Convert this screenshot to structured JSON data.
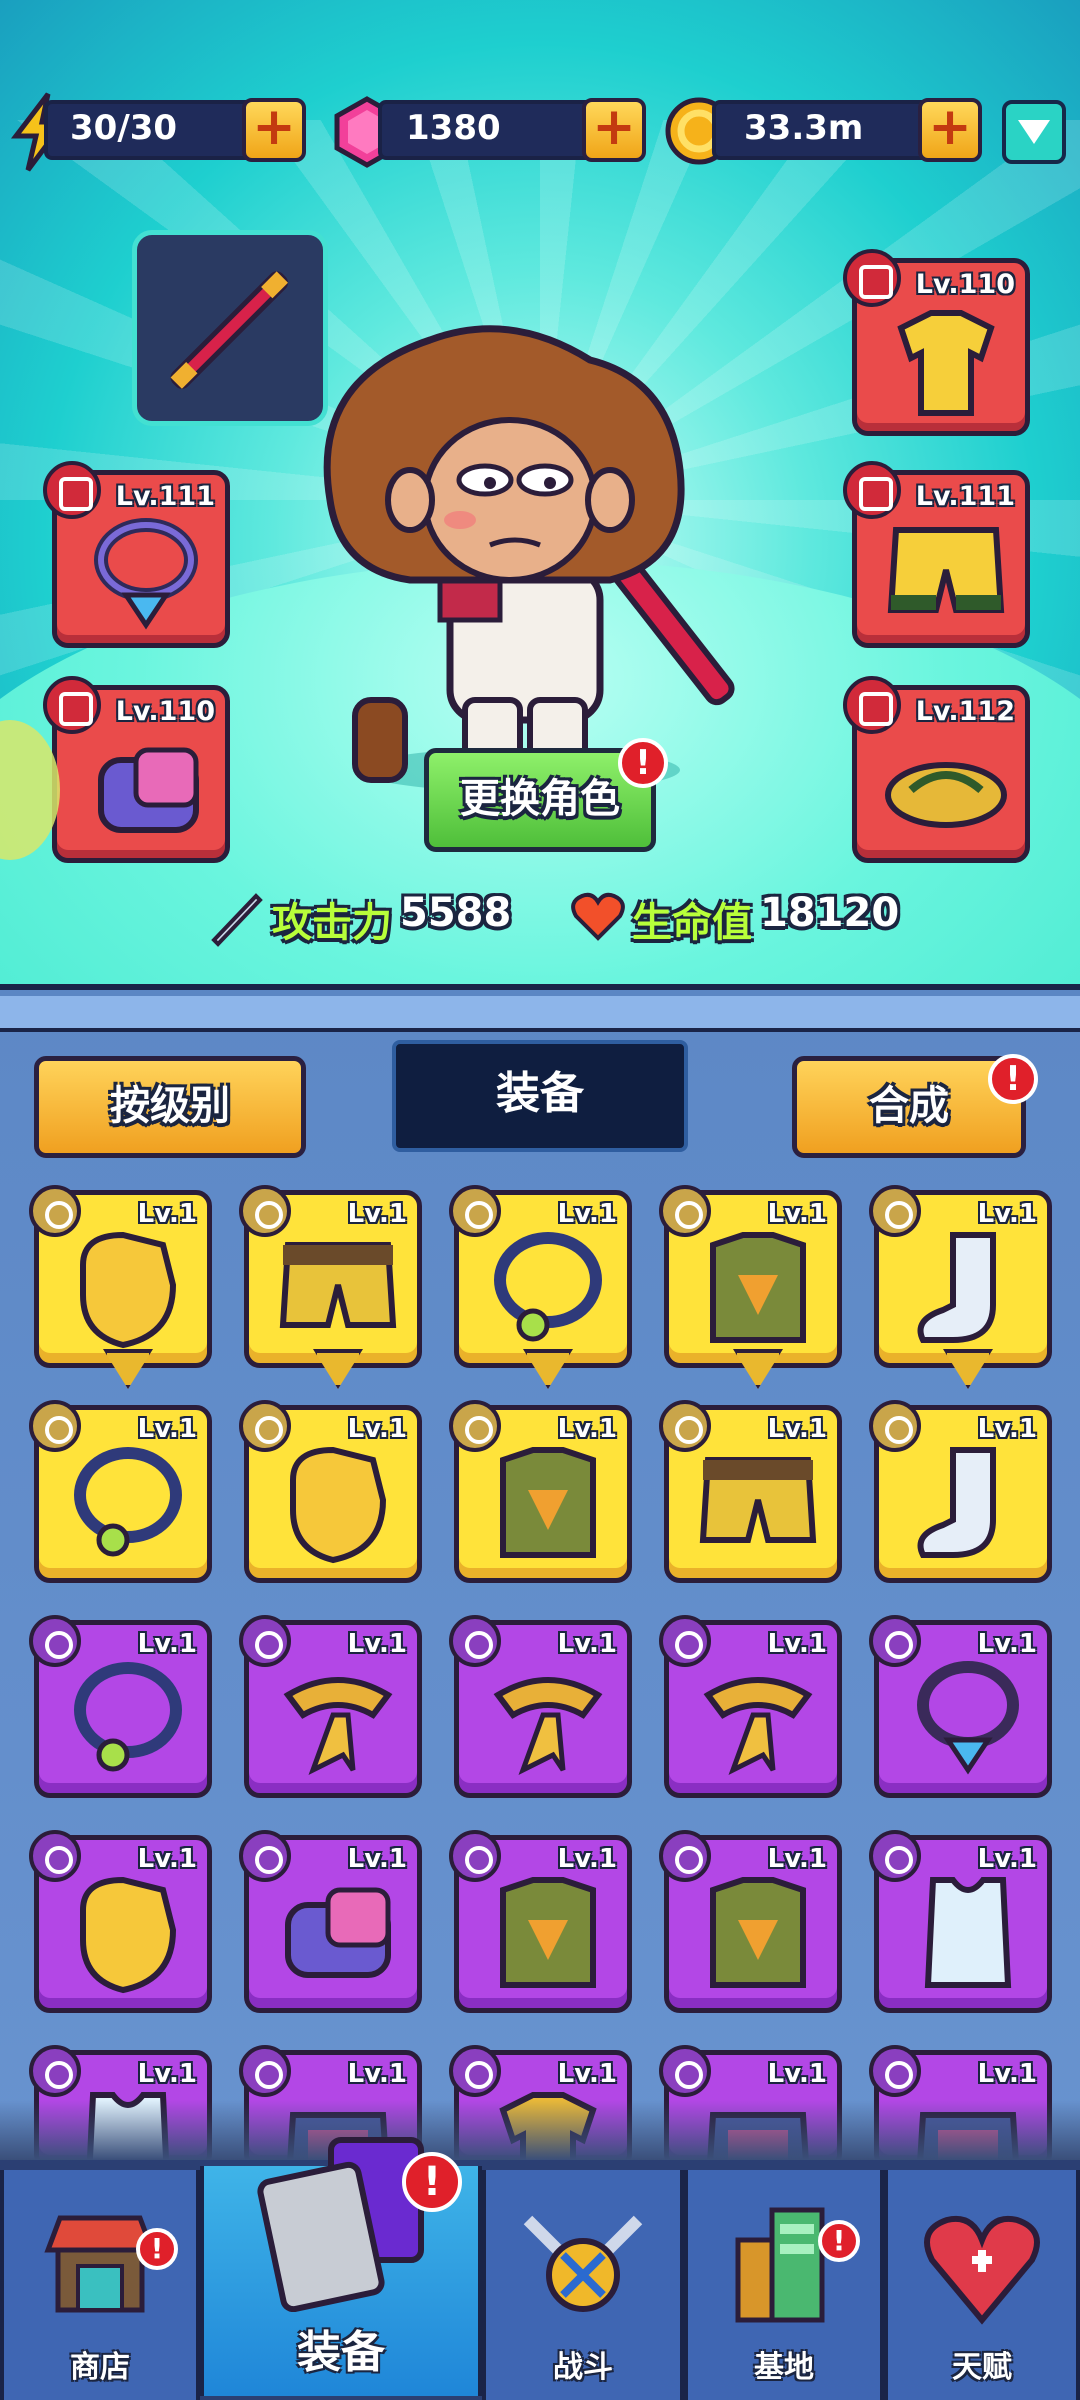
{
  "resources": {
    "energy": "30/30",
    "gems": "1380",
    "coins": "33.3m",
    "plus": "+"
  },
  "hero": {
    "slots_left": [
      {
        "level": "Lv.111",
        "type": "necklace"
      },
      {
        "level": "Lv.110",
        "type": "gauntlet"
      }
    ],
    "slots_right": [
      {
        "level": "Lv.110",
        "type": "shirt"
      },
      {
        "level": "Lv.111",
        "type": "shorts"
      },
      {
        "level": "Lv.112",
        "type": "sandals"
      }
    ],
    "change_button": "更换角色",
    "alert": "!",
    "attack_label": "攻击力",
    "attack_value": "5588",
    "hp_label": "生命值",
    "hp_value": "18120"
  },
  "toolbar": {
    "sort_label": "按级别",
    "tab_label": "装备",
    "synth_label": "合成"
  },
  "items": [
    {
      "level": "Lv.1",
      "rarity": "yellow",
      "kind": "glove"
    },
    {
      "level": "Lv.1",
      "rarity": "yellow",
      "kind": "shorts"
    },
    {
      "level": "Lv.1",
      "rarity": "yellow",
      "kind": "necklace"
    },
    {
      "level": "Lv.1",
      "rarity": "yellow",
      "kind": "vest"
    },
    {
      "level": "Lv.1",
      "rarity": "yellow",
      "kind": "sock"
    },
    {
      "level": "Lv.1",
      "rarity": "yellow",
      "kind": "necklace"
    },
    {
      "level": "Lv.1",
      "rarity": "yellow",
      "kind": "glove"
    },
    {
      "level": "Lv.1",
      "rarity": "yellow",
      "kind": "vest"
    },
    {
      "level": "Lv.1",
      "rarity": "yellow",
      "kind": "shorts"
    },
    {
      "level": "Lv.1",
      "rarity": "yellow",
      "kind": "sock"
    },
    {
      "level": "Lv.1",
      "rarity": "purple",
      "kind": "necklace"
    },
    {
      "level": "Lv.1",
      "rarity": "purple",
      "kind": "scarf"
    },
    {
      "level": "Lv.1",
      "rarity": "purple",
      "kind": "scarf"
    },
    {
      "level": "Lv.1",
      "rarity": "purple",
      "kind": "scarf"
    },
    {
      "level": "Lv.1",
      "rarity": "purple",
      "kind": "pendant"
    },
    {
      "level": "Lv.1",
      "rarity": "purple",
      "kind": "glove"
    },
    {
      "level": "Lv.1",
      "rarity": "purple",
      "kind": "gauntlet"
    },
    {
      "level": "Lv.1",
      "rarity": "purple",
      "kind": "vest"
    },
    {
      "level": "Lv.1",
      "rarity": "purple",
      "kind": "vest"
    },
    {
      "level": "Lv.1",
      "rarity": "purple",
      "kind": "tank"
    },
    {
      "level": "Lv.1",
      "rarity": "purple",
      "kind": "tank"
    },
    {
      "level": "Lv.1",
      "rarity": "purple",
      "kind": "armor"
    },
    {
      "level": "Lv.1",
      "rarity": "purple",
      "kind": "shirt"
    },
    {
      "level": "Lv.1",
      "rarity": "purple",
      "kind": "armor"
    },
    {
      "level": "Lv.1",
      "rarity": "purple",
      "kind": "armor"
    }
  ],
  "nav": [
    {
      "label": "商店",
      "icon": "shop-icon"
    },
    {
      "label": "装备",
      "icon": "cards-icon"
    },
    {
      "label": "战斗",
      "icon": "battle-icon"
    },
    {
      "label": "基地",
      "icon": "base-icon"
    },
    {
      "label": "天赋",
      "icon": "talent-icon"
    }
  ],
  "colors": {
    "slot_red": "#ea4b4b",
    "item_yellow": "#ffe33a",
    "item_purple": "#b347e6",
    "stat_green": "#b8ff3a"
  }
}
